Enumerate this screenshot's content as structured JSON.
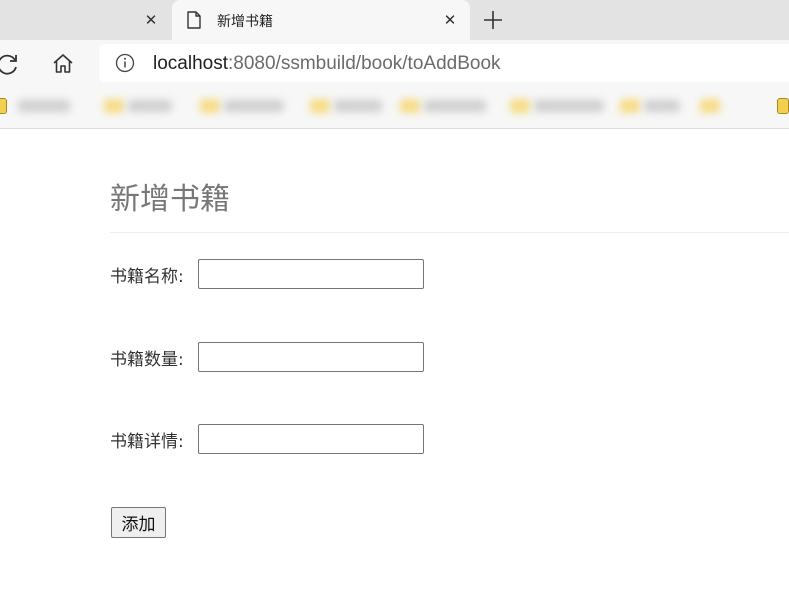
{
  "browser": {
    "tab_title": "新增书籍",
    "url_host": "localhost",
    "url_rest": ":8080/ssmbuild/book/toAddBook",
    "icons": {
      "reload": "reload-icon",
      "home": "home-icon",
      "info": "info-icon",
      "close": "close-icon",
      "new_tab": "plus-icon",
      "tab_page": "document-icon"
    }
  },
  "page": {
    "heading": "新增书籍",
    "form": {
      "fields": [
        {
          "label": "书籍名称:",
          "value": ""
        },
        {
          "label": "书籍数量:",
          "value": ""
        },
        {
          "label": "书籍详情:",
          "value": ""
        }
      ],
      "submit_label": "添加"
    }
  }
}
